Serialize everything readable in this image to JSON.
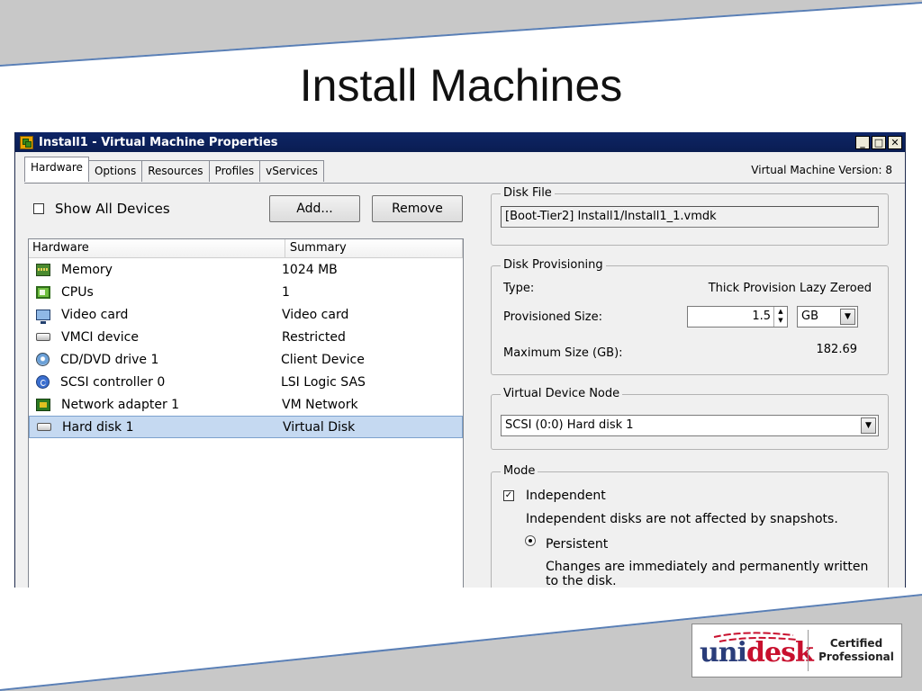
{
  "slide": {
    "title": "Install Machines"
  },
  "window": {
    "title": "Install1 - Virtual Machine Properties",
    "version": "Virtual Machine Version: 8",
    "tabs": [
      {
        "label": "Hardware",
        "active": true
      },
      {
        "label": "Options"
      },
      {
        "label": "Resources"
      },
      {
        "label": "Profiles"
      },
      {
        "label": "vServices"
      }
    ]
  },
  "hardware": {
    "show_all_label": "Show All Devices",
    "add_label": "Add...",
    "remove_label": "Remove",
    "col_hardware": "Hardware",
    "col_summary": "Summary",
    "items": [
      {
        "icon": "memory-icon",
        "name": "Memory",
        "summary": "1024 MB"
      },
      {
        "icon": "cpu-icon",
        "name": "CPUs",
        "summary": "1"
      },
      {
        "icon": "video-card-icon",
        "name": "Video card",
        "summary": "Video card"
      },
      {
        "icon": "vmci-device-icon",
        "name": "VMCI device",
        "summary": "Restricted"
      },
      {
        "icon": "cd-dvd-icon",
        "name": "CD/DVD drive 1",
        "summary": "Client Device"
      },
      {
        "icon": "scsi-controller-icon",
        "name": "SCSI controller 0",
        "summary": "LSI Logic SAS"
      },
      {
        "icon": "network-adapter-icon",
        "name": "Network adapter 1",
        "summary": "VM Network"
      },
      {
        "icon": "hard-disk-icon",
        "name": "Hard disk 1",
        "summary": "Virtual Disk",
        "selected": true
      }
    ]
  },
  "disk_file": {
    "legend": "Disk File",
    "value": "[Boot-Tier2] Install1/Install1_1.vmdk"
  },
  "provisioning": {
    "legend": "Disk Provisioning",
    "type_label": "Type:",
    "type_value": "Thick Provision Lazy Zeroed",
    "size_label": "Provisioned Size:",
    "size_value": "1.5",
    "unit_value": "GB",
    "max_label": "Maximum Size (GB):",
    "max_value": "182.69"
  },
  "device_node": {
    "legend": "Virtual Device Node",
    "value": "SCSI (0:0) Hard disk 1"
  },
  "mode": {
    "legend": "Mode",
    "independent_label": "Independent",
    "independent_checked": true,
    "independent_desc": "Independent disks are not affected by snapshots.",
    "persistent_label": "Persistent",
    "persistent_desc": "Changes are immediately and permanently written to the disk."
  },
  "badge": {
    "certified": "Certified",
    "professional": "Professional",
    "logo_part1": "uni",
    "logo_part2": "desk"
  },
  "colors": {
    "titlebar": "#0e2566",
    "selection": "#c5d9f1",
    "logo_blue": "#2a3d7a",
    "logo_red": "#c8102e"
  }
}
